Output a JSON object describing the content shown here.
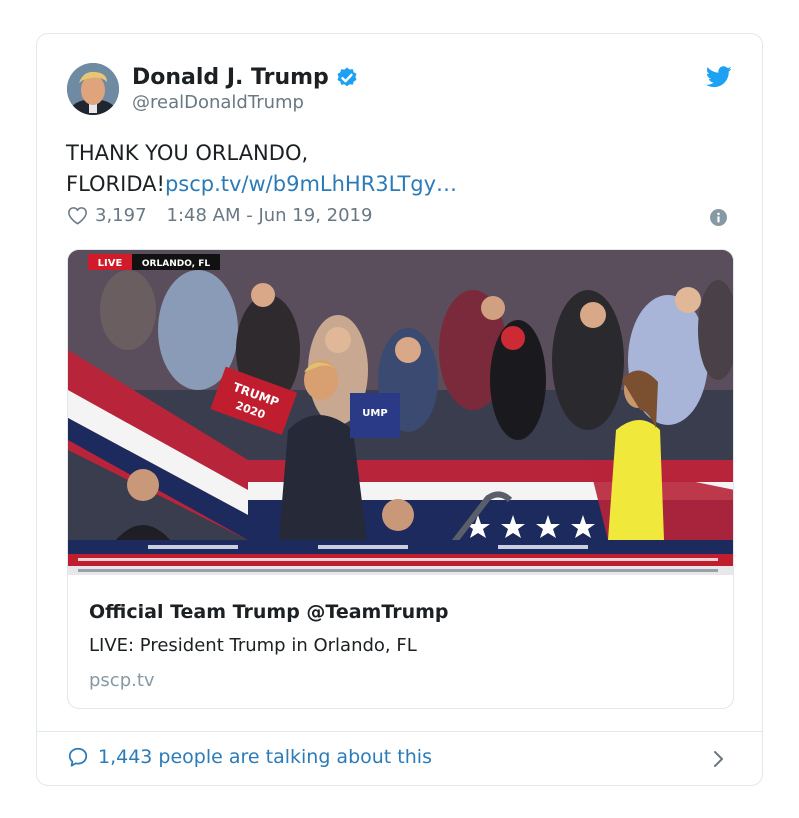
{
  "tweet": {
    "author_name": "Donald J. Trump",
    "author_handle": "@realDonaldTrump",
    "text_line1": "THANK YOU ORLANDO,",
    "text_line2": "FLORIDA!",
    "link_text": "pscp.tv/w/b9mLhHR3LTgy…",
    "likes": "3,197",
    "timestamp": "1:48 AM - Jun 19, 2019",
    "icons": {
      "verified": "verified-badge-icon",
      "bird": "twitter-bird-icon",
      "like": "heart-icon",
      "info": "info-icon",
      "reply": "speech-bubble-icon",
      "more": "chevron-right-icon"
    }
  },
  "media_card": {
    "overlay_live": "LIVE",
    "overlay_location": "ORLANDO, FL",
    "sign_text_1": "TRUMP",
    "sign_text_2": "2020",
    "title": "Official Team Trump @TeamTrump",
    "description": "LIVE: President Trump in Orlando, FL",
    "domain": "pscp.tv"
  },
  "footer": {
    "talking": "1,443 people are talking about this"
  },
  "colors": {
    "link": "#2b7bb9",
    "secondary": "#697882",
    "border": "#e1e8ed",
    "verified": "#1da1f2"
  }
}
